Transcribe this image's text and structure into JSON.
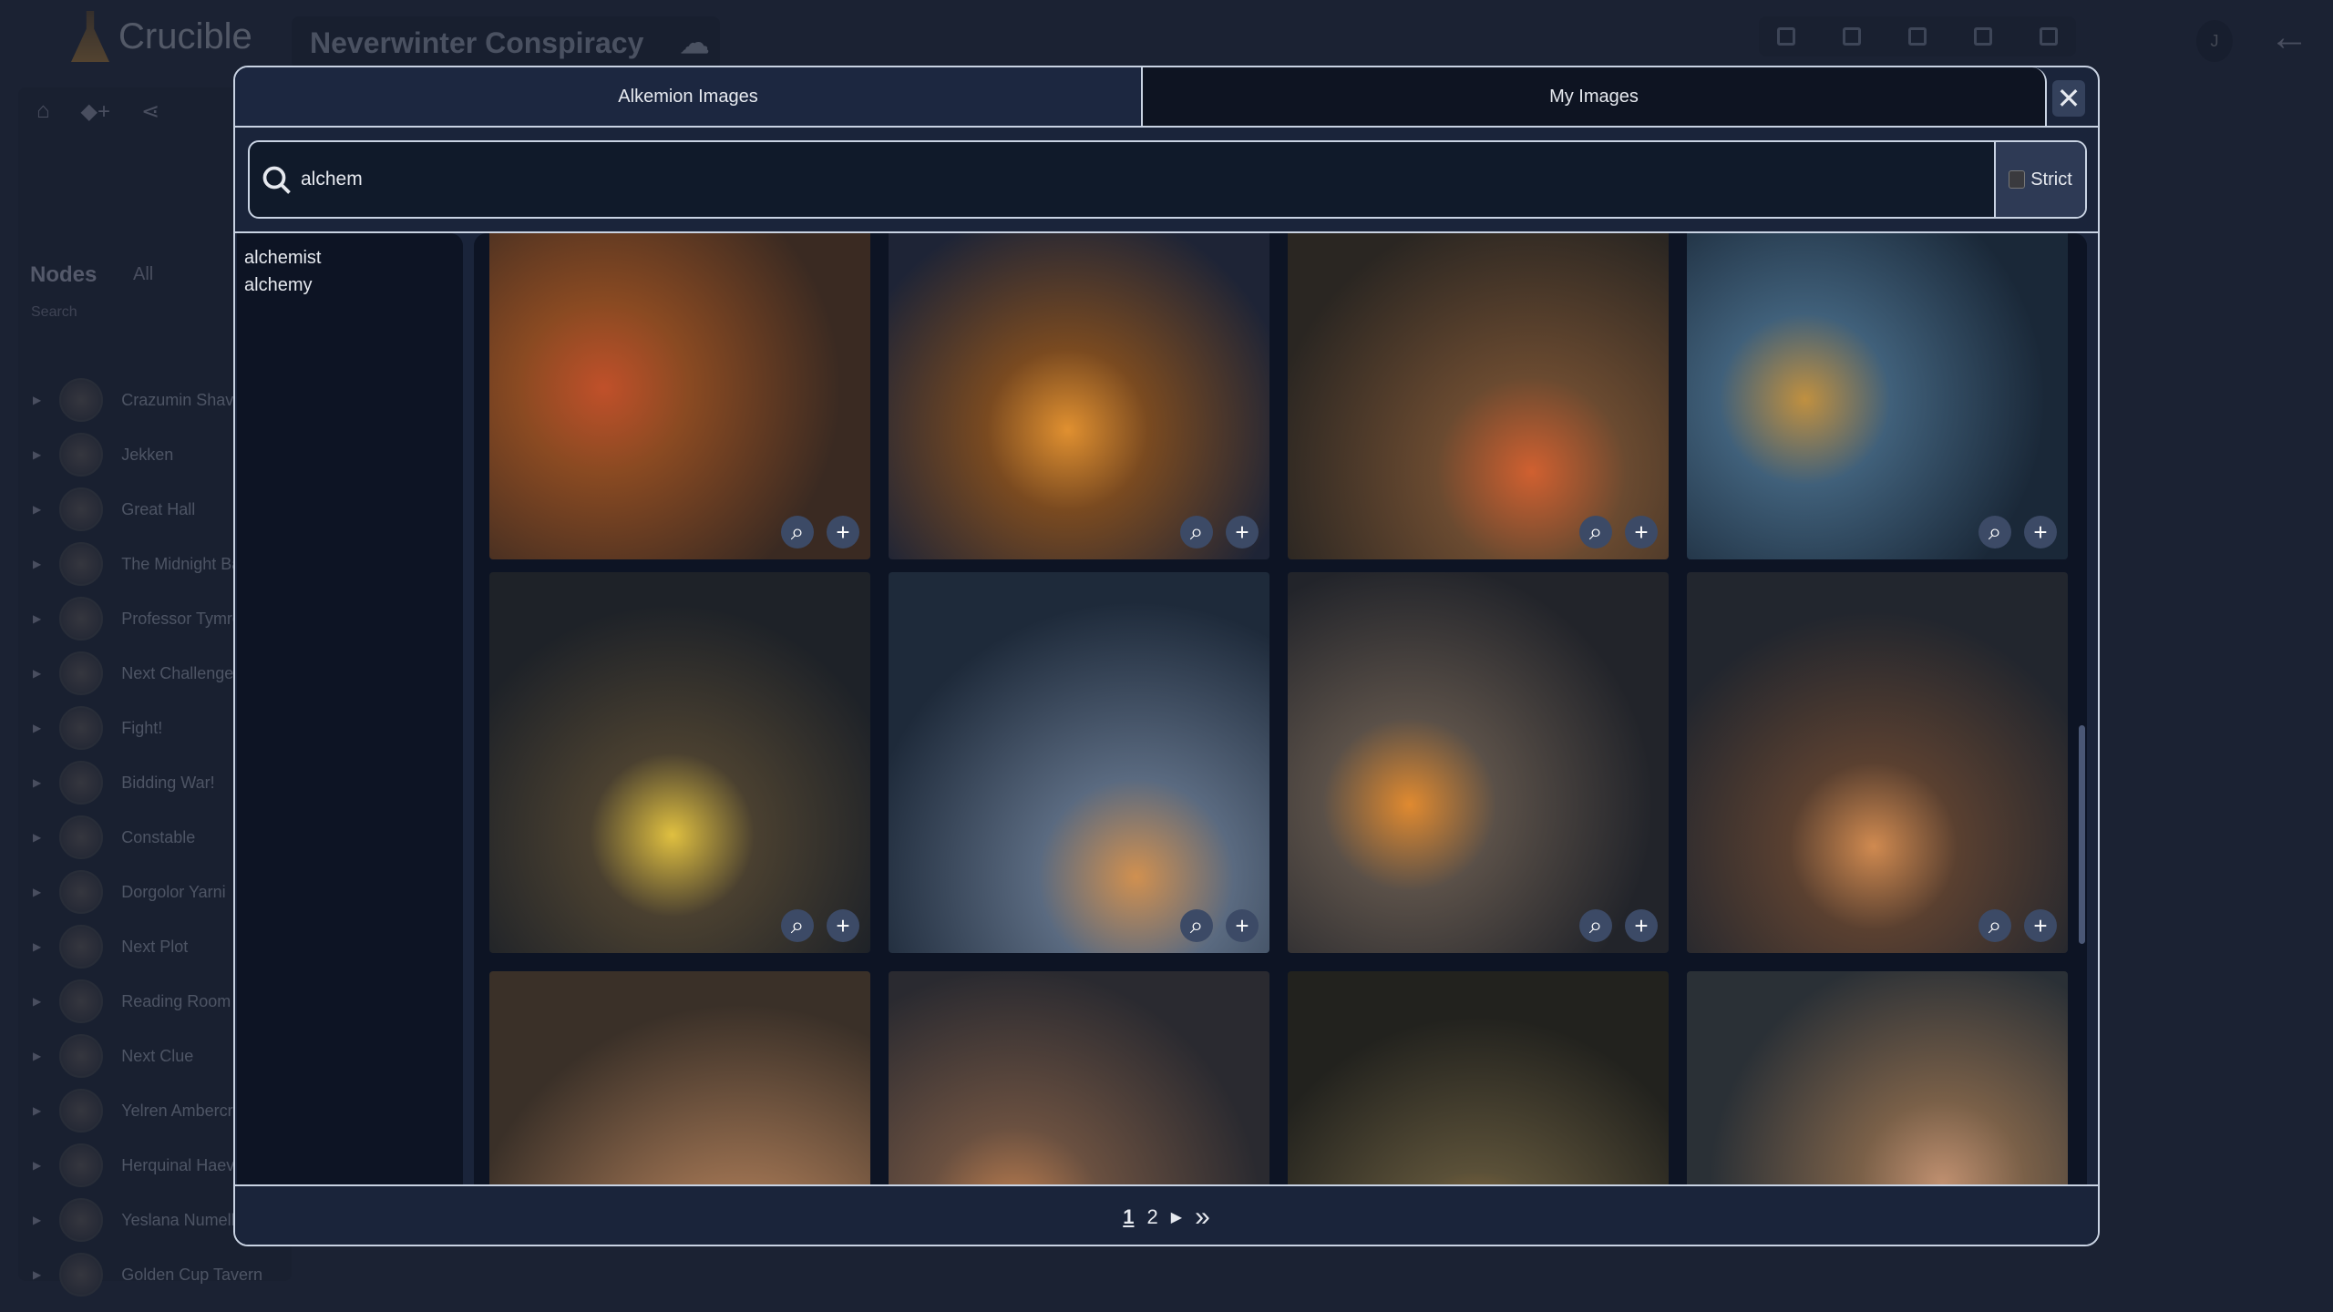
{
  "app": {
    "name": "Crucible",
    "project": "Neverwinter Conspiracy",
    "user_initial": "J"
  },
  "sidebar": {
    "title": "Nodes",
    "filter": "All",
    "search_placeholder": "Search",
    "nodes": [
      "Crazumin Shavarn",
      "Jekken",
      "Great Hall",
      "The Midnight Bazaar",
      "Professor Tymron",
      "Next Challenge",
      "Fight!",
      "Bidding War!",
      "Constable",
      "Dorgolor Yarni",
      "Next Plot",
      "Reading Room",
      "Next Clue",
      "Yelren Ambercrow",
      "Herquinal Haevar",
      "Yeslana Numelkal",
      "Golden Cup Tavern"
    ]
  },
  "modal": {
    "tabs": [
      {
        "label": "Alkemion Images",
        "active": true
      },
      {
        "label": "My Images",
        "active": false
      }
    ],
    "search": {
      "value": "alchem",
      "strict_label": "Strict",
      "strict_checked": false
    },
    "suggestions": [
      "alchemist",
      "alchemy"
    ],
    "image_count_visible": 12,
    "pagination": {
      "pages": [
        "1",
        "2"
      ],
      "current": "1",
      "next": "▶",
      "last": "»"
    }
  },
  "colors": {
    "modal_bg": "#1a243a",
    "border": "#c9d3e3",
    "button": "#3c4a66"
  }
}
